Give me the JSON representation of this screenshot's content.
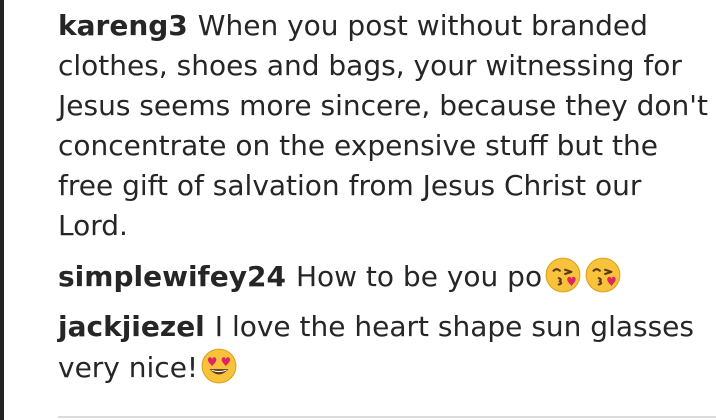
{
  "comments": [
    {
      "username": "kareng3",
      "text": "When you post without branded clothes, shoes and bags, your witnessing for Jesus seems more sincere, because they don't concentrate on the expensive stuff but the free gift of salvation from Jesus Christ our Lord."
    },
    {
      "username": "simplewifey24",
      "text": "How to be you po",
      "emojis": [
        "face-blowing-kiss-icon",
        "face-blowing-kiss-icon"
      ]
    },
    {
      "username": "jackjiezel",
      "text": "I love the heart shape sun glasses very nice!",
      "emojis": [
        "heart-eyes-face-icon"
      ]
    }
  ],
  "colors": {
    "text": "#262626",
    "emoji_face": "#F9C23C",
    "heart": "#E0245E",
    "divider": "#dbdbdb"
  }
}
